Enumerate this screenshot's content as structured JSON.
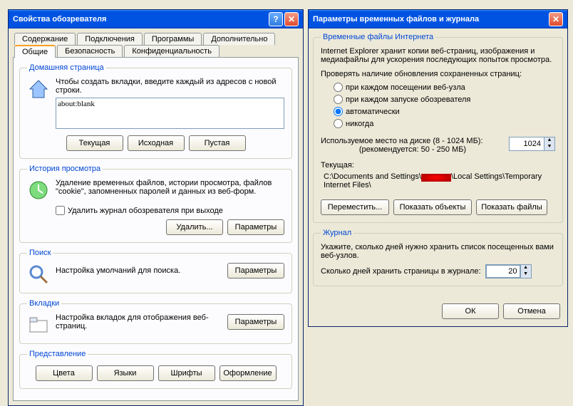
{
  "dlg1": {
    "title": "Свойства обозревателя",
    "tabs_row1": [
      "Содержание",
      "Подключения",
      "Программы",
      "Дополнительно"
    ],
    "tabs_row2": [
      "Общие",
      "Безопасность",
      "Конфиденциальность"
    ],
    "homepage": {
      "legend": "Домашняя страница",
      "desc": "Чтобы создать вкладки, введите каждый из адресов с новой строки.",
      "value": "about:blank",
      "btn_current": "Текущая",
      "btn_default": "Исходная",
      "btn_blank": "Пустая"
    },
    "history": {
      "legend": "История просмотра",
      "desc": "Удаление временных файлов, истории просмотра, файлов \"cookie\", запомненных паролей и данных из веб-форм.",
      "chk": "Удалить журнал обозревателя при выходе",
      "btn_delete": "Удалить...",
      "btn_settings": "Параметры"
    },
    "search": {
      "legend": "Поиск",
      "desc": "Настройка умолчаний для поиска.",
      "btn": "Параметры"
    },
    "tabs": {
      "legend": "Вкладки",
      "desc": "Настройка вкладок для отображения веб-страниц.",
      "btn": "Параметры"
    },
    "appearance": {
      "legend": "Представление",
      "btn_colors": "Цвета",
      "btn_lang": "Языки",
      "btn_fonts": "Шрифты",
      "btn_access": "Оформление"
    }
  },
  "dlg2": {
    "title": "Параметры временных файлов и журнала",
    "tif": {
      "legend": "Временные файлы Интернета",
      "desc": "Internet Explorer хранит копии веб-страниц, изображения и медиафайлы для ускорения последующих попыток просмотра.",
      "check_label": "Проверять наличие обновления сохраненных страниц:",
      "opt1": "при каждом посещении веб-узла",
      "opt2": "при каждом запуске обозревателя",
      "opt3": "автоматически",
      "opt4": "никогда",
      "disk_label": "Используемое место на диске (8 - 1024 МБ):",
      "disk_rec": "(рекомендуется: 50 - 250 МБ)",
      "disk_value": "1024",
      "cur_label": "Текущая:",
      "path_pre": "C:\\Documents and Settings\\",
      "path_post": "\\Local Settings\\Temporary Internet Files\\",
      "btn_move": "Переместить...",
      "btn_objects": "Показать объекты",
      "btn_files": "Показать файлы"
    },
    "journal": {
      "legend": "Журнал",
      "desc": "Укажите, сколько дней нужно хранить список посещенных вами веб-узлов.",
      "days_label": "Сколько дней хранить страницы в журнале:",
      "days_value": "20"
    },
    "btn_ok": "ОК",
    "btn_cancel": "Отмена"
  }
}
